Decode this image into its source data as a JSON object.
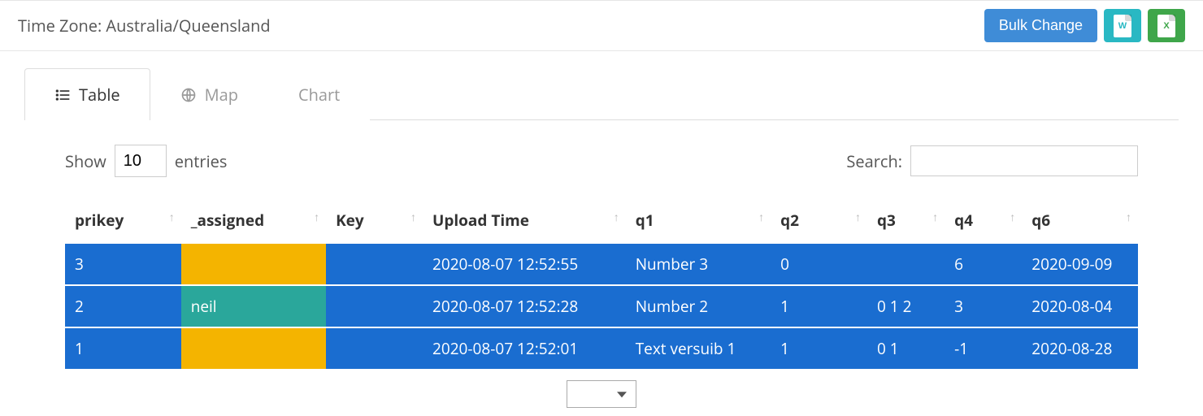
{
  "header": {
    "timezone_label": "Time Zone: Australia/Queensland",
    "bulk_change_label": "Bulk Change",
    "word_icon_letter": "W",
    "excel_icon_letter": "X"
  },
  "tabs": {
    "table_label": "Table",
    "map_label": "Map",
    "chart_label": "Chart",
    "active": "Table"
  },
  "table_controls": {
    "show_label": "Show",
    "entries_label": "entries",
    "entries_value": "10",
    "search_label": "Search:",
    "search_value": ""
  },
  "columns": [
    {
      "key": "prikey",
      "label": "prikey"
    },
    {
      "key": "_assigned",
      "label": "_assigned"
    },
    {
      "key": "Key",
      "label": "Key"
    },
    {
      "key": "Upload Time",
      "label": "Upload Time"
    },
    {
      "key": "q1",
      "label": "q1"
    },
    {
      "key": "q2",
      "label": "q2"
    },
    {
      "key": "q3",
      "label": "q3"
    },
    {
      "key": "q4",
      "label": "q4"
    },
    {
      "key": "q6",
      "label": "q6"
    }
  ],
  "rows": [
    {
      "prikey": "3",
      "_assigned": "",
      "_assigned_state": "empty",
      "Key": "",
      "Upload Time": "2020-08-07 12:52:55",
      "q1": "Number 3",
      "q2": "0",
      "q3": "",
      "q4": "6",
      "q6": "2020-09-09"
    },
    {
      "prikey": "2",
      "_assigned": "neil",
      "_assigned_state": "filled",
      "Key": "",
      "Upload Time": "2020-08-07 12:52:28",
      "q1": "Number 2",
      "q2": "1",
      "q3": "0 1 2",
      "q4": "3",
      "q6": "2020-08-04"
    },
    {
      "prikey": "1",
      "_assigned": "",
      "_assigned_state": "empty",
      "Key": "",
      "Upload Time": "2020-08-07 12:52:01",
      "q1": "Text versuib 1",
      "q2": "1",
      "q3": "0 1",
      "q4": "-1",
      "q6": "2020-08-28"
    }
  ],
  "pager": {
    "selected": ""
  }
}
